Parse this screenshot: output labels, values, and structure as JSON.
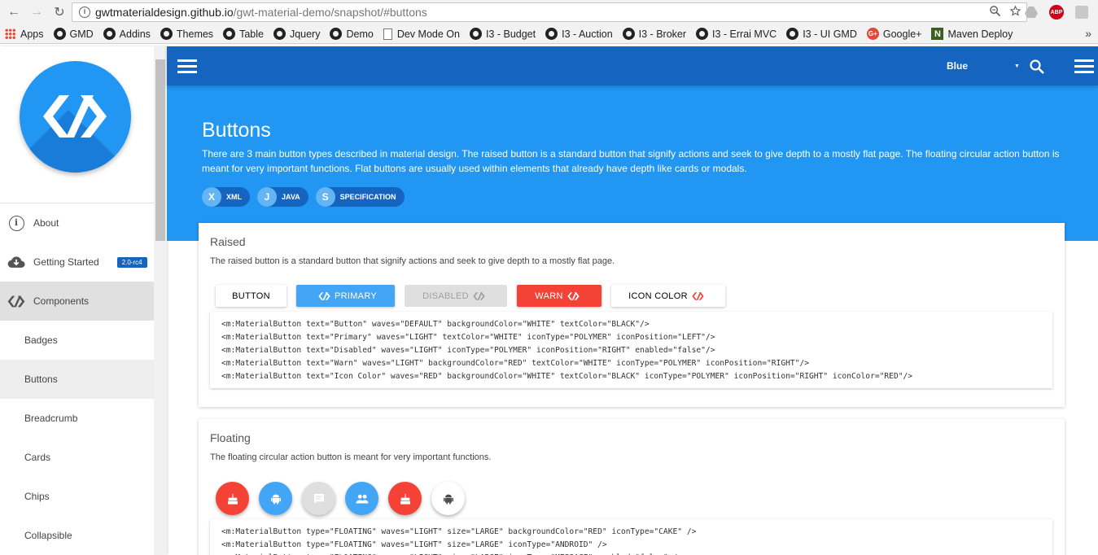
{
  "browser": {
    "url_host": "gwtmaterialdesign.github.io",
    "url_path": "/gwt-material-demo/snapshot/#buttons",
    "extensions": {
      "adblock_label": "ABP"
    },
    "bookmarks": [
      {
        "label": "Apps",
        "icon": "apps-icon"
      },
      {
        "label": "GMD",
        "icon": "github-icon"
      },
      {
        "label": "Addins",
        "icon": "github-icon"
      },
      {
        "label": "Themes",
        "icon": "github-icon"
      },
      {
        "label": "Table",
        "icon": "github-icon"
      },
      {
        "label": "Jquery",
        "icon": "github-icon"
      },
      {
        "label": "Demo",
        "icon": "github-icon"
      },
      {
        "label": "Dev Mode On",
        "icon": "page-icon"
      },
      {
        "label": "I3 - Budget",
        "icon": "github-icon"
      },
      {
        "label": "I3 - Auction",
        "icon": "github-icon"
      },
      {
        "label": "I3 - Broker",
        "icon": "github-icon"
      },
      {
        "label": "I3 - Errai MVC",
        "icon": "github-icon"
      },
      {
        "label": "I3 - UI GMD",
        "icon": "github-icon"
      },
      {
        "label": "Google+",
        "icon": "google-plus-icon"
      },
      {
        "label": "Maven Deploy",
        "icon": "maven-icon"
      }
    ],
    "bookmarks_more": "»",
    "google_plus_glyph": "G+",
    "maven_glyph": "N"
  },
  "sidebar": {
    "items": [
      {
        "label": "About",
        "type": "top",
        "icon": "info-icon"
      },
      {
        "label": "Getting Started",
        "type": "top",
        "icon": "cloud-download-icon",
        "badge": "2.0-rc4"
      },
      {
        "label": "Components",
        "type": "top",
        "icon": "polymer-icon",
        "active": true
      },
      {
        "label": "Badges",
        "type": "sub"
      },
      {
        "label": "Buttons",
        "type": "sub",
        "selected": true
      },
      {
        "label": "Breadcrumb",
        "type": "sub"
      },
      {
        "label": "Cards",
        "type": "sub"
      },
      {
        "label": "Chips",
        "type": "sub"
      },
      {
        "label": "Collapsible",
        "type": "sub"
      }
    ],
    "info_glyph": "i"
  },
  "header": {
    "color_value": "Blue",
    "caret": "▼"
  },
  "hero": {
    "title": "Buttons",
    "description": "There are 3 main button types described in material design. The raised button is a standard button that signify actions and seek to give depth to a mostly flat page. The floating circular action button is meant for very important functions. Flat buttons are usually used within elements that already have depth like cards or modals.",
    "chips": [
      {
        "letter": "X",
        "label": "XML"
      },
      {
        "letter": "J",
        "label": "JAVA"
      },
      {
        "letter": "S",
        "label": "SPECIFICATION"
      }
    ]
  },
  "raised": {
    "title": "Raised",
    "description": "The raised button is a standard button that signify actions and seek to give depth to a mostly flat page.",
    "buttons": [
      {
        "label": "Button",
        "name": "button-button",
        "bg": "#ffffff",
        "fg": "#000000",
        "icon": "",
        "enabled": true
      },
      {
        "label": "Primary",
        "name": "primary-button",
        "bg": "#42a5f5",
        "fg": "#ffffff",
        "icon": "left",
        "enabled": true
      },
      {
        "label": "Disabled",
        "name": "disabled-button",
        "bg": "#dfdfdf",
        "fg": "#9f9f9f",
        "icon": "right",
        "enabled": false
      },
      {
        "label": "Warn",
        "name": "warn-button",
        "bg": "#f44336",
        "fg": "#ffffff",
        "icon": "right",
        "enabled": true
      },
      {
        "label": "Icon Color",
        "name": "icon-color-button",
        "bg": "#ffffff",
        "fg": "#000000",
        "icon": "right",
        "icon_color": "#f44336",
        "enabled": true
      }
    ],
    "code": [
      "<m:MaterialButton text=\"Button\" waves=\"DEFAULT\" backgroundColor=\"WHITE\" textColor=\"BLACK\"/>",
      "<m:MaterialButton text=\"Primary\" waves=\"LIGHT\" textColor=\"WHITE\" iconType=\"POLYMER\" iconPosition=\"LEFT\"/>",
      "<m:MaterialButton text=\"Disabled\" waves=\"LIGHT\" iconType=\"POLYMER\" iconPosition=\"RIGHT\" enabled=\"false\"/>",
      "<m:MaterialButton text=\"Warn\" waves=\"LIGHT\" backgroundColor=\"RED\" textColor=\"WHITE\" iconType=\"POLYMER\" iconPosition=\"RIGHT\"/>",
      "<m:MaterialButton text=\"Icon Color\" waves=\"RED\" backgroundColor=\"WHITE\" textColor=\"BLACK\" iconType=\"POLYMER\" iconPosition=\"RIGHT\" iconColor=\"RED\"/>"
    ]
  },
  "floating": {
    "title": "Floating",
    "description": "The floating circular action button is meant for very important functions.",
    "buttons": [
      {
        "name": "fab-cake",
        "icon": "cake-icon",
        "bg": "#f44336",
        "fg": "#ffffff"
      },
      {
        "name": "fab-android",
        "icon": "android-icon",
        "bg": "#42a5f5",
        "fg": "#ffffff"
      },
      {
        "name": "fab-comment",
        "icon": "comment-icon",
        "bg": "#dfdfdf",
        "fg": "#ffffff"
      },
      {
        "name": "fab-people",
        "icon": "people-icon",
        "bg": "#42a5f5",
        "fg": "#ffffff"
      },
      {
        "name": "fab-cake-red",
        "icon": "cake-icon",
        "bg": "#f44336",
        "fg": "#ffffff"
      },
      {
        "name": "fab-android-white",
        "icon": "android-icon",
        "bg": "#ffffff",
        "fg": "#4d4d4d"
      }
    ],
    "code": [
      "<m:MaterialButton type=\"FLOATING\" waves=\"LIGHT\" size=\"LARGE\" backgroundColor=\"RED\" iconType=\"CAKE\" />",
      "<m:MaterialButton type=\"FLOATING\" waves=\"LIGHT\" size=\"LARGE\" iconType=\"ANDROID\" />",
      "<m:MaterialButton type=\"FLOATING\" waves=\"LIGHT\" size=\"LARGE\" iconType=\"MESSAGE\" enabled=\"false\" />"
    ]
  },
  "colors": {
    "header_blue": "#1565c0",
    "hero_blue": "#2196f3",
    "accent_red": "#f44336"
  }
}
